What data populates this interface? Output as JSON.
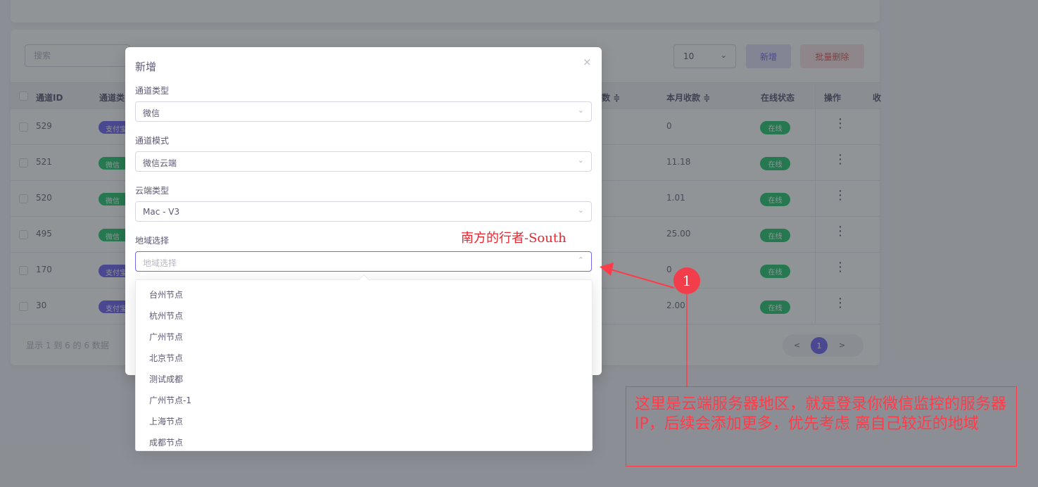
{
  "toolbar": {
    "search_placeholder": "搜索",
    "page_size": "10",
    "add_label": "新增",
    "batch_delete_label": "批量删除"
  },
  "table": {
    "headers": {
      "id": "通道ID",
      "type": "通道类",
      "day_income": "数 ≑",
      "month_income": "本月收款 ≑",
      "status": "在线状态",
      "action": "操作",
      "extra": "收"
    },
    "rows": [
      {
        "id": "529",
        "type": "支付宝",
        "type_color": "#7367f0",
        "month": "0",
        "status": "在线"
      },
      {
        "id": "521",
        "type": "微信",
        "type_color": "#28c76f",
        "month": "11.18",
        "status": "在线"
      },
      {
        "id": "520",
        "type": "微信",
        "type_color": "#28c76f",
        "month": "1.01",
        "status": "在线"
      },
      {
        "id": "495",
        "type": "微信",
        "type_color": "#28c76f",
        "month": "25.00",
        "status": "在线"
      },
      {
        "id": "170",
        "type": "支付宝",
        "type_color": "#7367f0",
        "month": "0",
        "status": "在线"
      },
      {
        "id": "30",
        "type": "支付宝",
        "type_color": "#7367f0",
        "month": "2.00",
        "status": "在线"
      }
    ],
    "footer": "显示 1 到 6 的 6 数据",
    "pager": {
      "prev": "<",
      "current": "1",
      "next": ">"
    }
  },
  "modal": {
    "title": "新增",
    "close": "×",
    "fields": {
      "channel_type": {
        "label": "通道类型",
        "value": "微信"
      },
      "channel_mode": {
        "label": "通道模式",
        "value": "微信云端"
      },
      "cloud_type": {
        "label": "云端类型",
        "value": "Mac - V3"
      },
      "region": {
        "label": "地域选择",
        "placeholder": "地域选择"
      }
    },
    "region_options": [
      "台州节点",
      "杭州节点",
      "广州节点",
      "北京节点",
      "测试成都",
      "广州节点-1",
      "上海节点",
      "成都节点"
    ]
  },
  "annotation": {
    "watermark": "南方的行者-South",
    "step_number": "1",
    "callout": "这里是云端服务器地区，就是登录你微信监控的服务器IP，后续会添加更多，优先考虑 离自己较近的地域",
    "color": "#ff3b4a"
  },
  "colors": {
    "primary": "#7367f0",
    "success": "#28c76f",
    "danger": "#ea5455"
  }
}
